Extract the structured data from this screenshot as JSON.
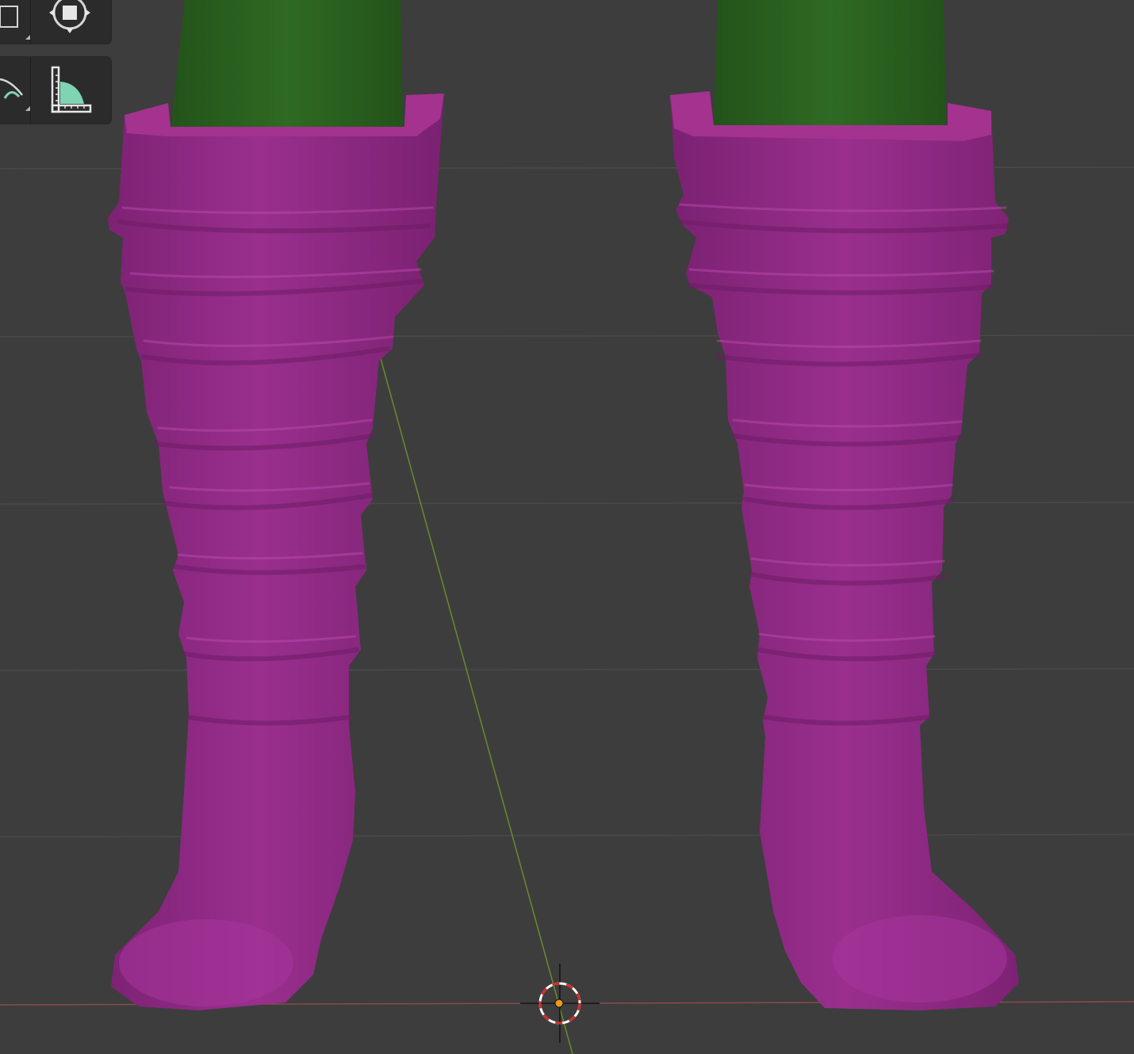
{
  "app": {
    "view_background": "#3d3d3d",
    "grid_line_color": "#4a4a4a",
    "x_axis_color": "#8a4b4b",
    "y_axis_color": "#6a8a2e"
  },
  "toolbar": {
    "tools": [
      {
        "name": "scale-cage-tool",
        "icon": "scale-cage-icon",
        "active": false
      },
      {
        "name": "transform-tool",
        "icon": "transform-icon",
        "active": false
      },
      {
        "name": "annotate-tool",
        "icon": "curve-icon",
        "active": false
      },
      {
        "name": "measure-tool",
        "icon": "measure-icon",
        "active": false
      }
    ],
    "panel_color": "#2b2b2b",
    "accent_color": "#7ed4b3"
  },
  "scene": {
    "boot_color": "#8e2a83",
    "boot_highlight": "#a8359c",
    "leg_color": "#2f6a22",
    "cursor_icon": "3d-cursor-icon",
    "origin_icon": "origin-dot-icon",
    "origin_color": "#e89b1a"
  }
}
